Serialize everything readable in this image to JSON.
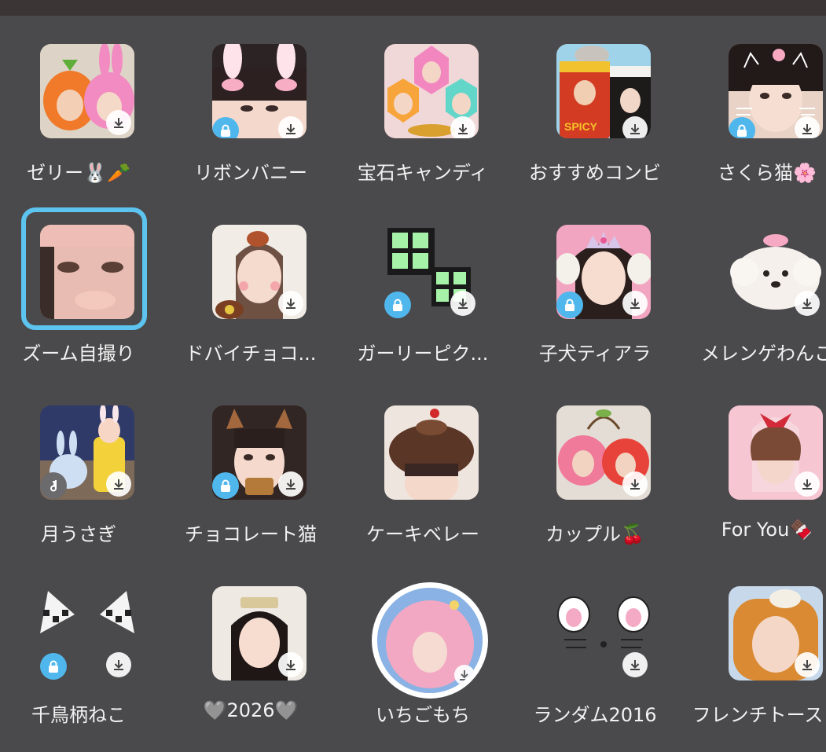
{
  "colors": {
    "background": "#4a494b",
    "topbar": "#3b3536",
    "label_text": "#f2f2f2",
    "lock_badge": "#4fb7ec",
    "selected_ring": "#5cc4ee",
    "download_badge": "#ffffff"
  },
  "filters": [
    {
      "label": "ゼリー🐰🥕",
      "locked": false,
      "download": true
    },
    {
      "label": "リボンバニー",
      "locked": true,
      "download": true
    },
    {
      "label": "宝石キャンディ",
      "locked": false,
      "download": true
    },
    {
      "label": "おすすめコンビ",
      "locked": false,
      "download": true
    },
    {
      "label": "さくら猫🌸",
      "locked": true,
      "download": true
    },
    {
      "label": "ズーム自撮り",
      "locked": false,
      "download": false,
      "selected": true
    },
    {
      "label": "ドバイチョコ...",
      "locked": false,
      "download": true
    },
    {
      "label": "ガーリーピク...",
      "locked": true,
      "download": true
    },
    {
      "label": "子犬ティアラ",
      "locked": true,
      "download": true
    },
    {
      "label": "メレンゲわんこ",
      "locked": false,
      "download": true
    },
    {
      "label": "月うさぎ",
      "locked": false,
      "download": true,
      "music": true
    },
    {
      "label": "チョコレート猫",
      "locked": true,
      "download": true
    },
    {
      "label": "ケーキベレー",
      "locked": false,
      "download": false
    },
    {
      "label": "カップル🍒",
      "locked": false,
      "download": true
    },
    {
      "label": "For You🍫",
      "locked": false,
      "download": true
    },
    {
      "label": "千鳥柄ねこ",
      "locked": true,
      "download": true
    },
    {
      "label": "🩶2026🩶",
      "locked": false,
      "download": true
    },
    {
      "label": "いちごもち",
      "locked": false,
      "download": true,
      "circle": true
    },
    {
      "label": "ランダム2016",
      "locked": false,
      "download": true
    },
    {
      "label": "フレンチトースト",
      "locked": false,
      "download": true
    }
  ]
}
